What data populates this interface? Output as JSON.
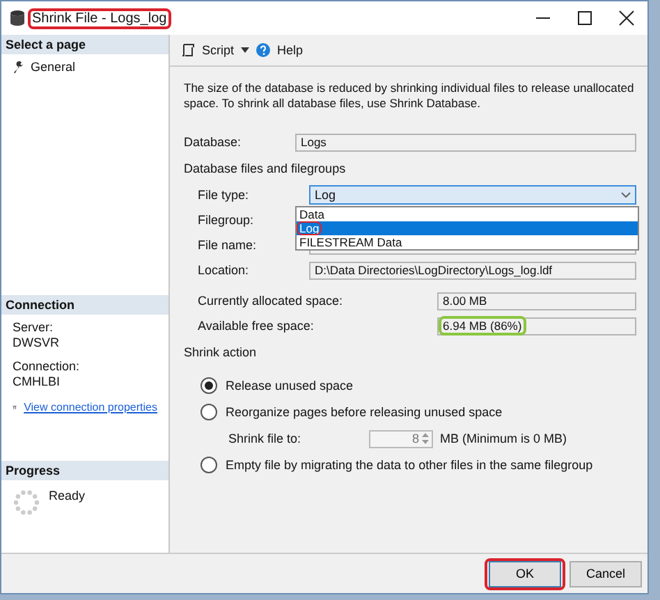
{
  "window": {
    "title": "Shrink File - Logs_log",
    "highlighted": true
  },
  "sidebar": {
    "header": "Select a page",
    "items": [
      {
        "label": "General"
      }
    ]
  },
  "connection": {
    "header": "Connection",
    "server_label": "Server:",
    "server": "DWSVR",
    "connection_label": "Connection:",
    "connection": "CMHLBI",
    "link": "View connection properties"
  },
  "progress": {
    "header": "Progress",
    "status": "Ready"
  },
  "toolbar": {
    "script": "Script",
    "help": "Help"
  },
  "description": "The size of the database is reduced by shrinking individual files to release unallocated space. To shrink all database files, use Shrink Database.",
  "database": {
    "label": "Database:",
    "value": "Logs"
  },
  "files_section": "Database files and filegroups",
  "file_type": {
    "label": "File type:",
    "value": "Log",
    "expanded": true,
    "options": [
      {
        "label": "Data",
        "selected": false,
        "highlighted": false
      },
      {
        "label": "Log",
        "selected": true,
        "highlighted": true
      },
      {
        "label": "FILESTREAM Data",
        "selected": false,
        "highlighted": false
      }
    ]
  },
  "filegroup": {
    "label": "Filegroup:"
  },
  "file_name": {
    "label": "File name:"
  },
  "location": {
    "label": "Location:",
    "value": "D:\\Data Directories\\LogDirectory\\Logs_log.ldf"
  },
  "allocated": {
    "label": "Currently allocated space:",
    "value": "8.00 MB"
  },
  "free": {
    "label": "Available free space:",
    "value": "6.94 MB (86%)",
    "highlighted": true
  },
  "shrink_action": {
    "title": "Shrink action",
    "options": [
      {
        "kind": "radio",
        "label": "Release unused space",
        "selected": true
      },
      {
        "kind": "radio",
        "label": "Reorganize pages before releasing unused space",
        "selected": false
      },
      {
        "kind": "size",
        "label": "Shrink file to:",
        "value": "8",
        "unit": "MB (Minimum is 0 MB)",
        "disabled": true
      },
      {
        "kind": "radio",
        "label": "Empty file by migrating the data to other files in the same filegroup",
        "selected": false
      }
    ]
  },
  "buttons": [
    {
      "label": "OK",
      "highlighted": true
    },
    {
      "label": "Cancel",
      "highlighted": false
    }
  ]
}
